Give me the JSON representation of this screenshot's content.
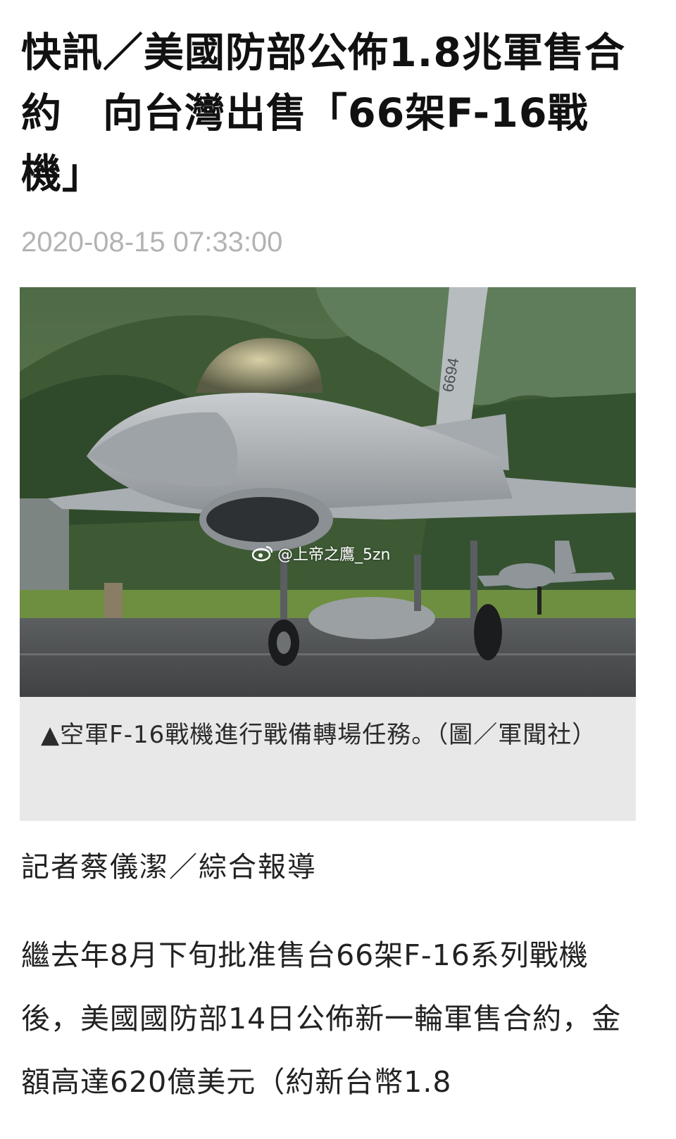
{
  "article": {
    "headline": "快訊／美國防部公佈1.8兆軍售合約　向台灣出售「66架F-16戰機」",
    "timestamp": "2020-08-15 07:33:00",
    "photo": {
      "watermark": "@上帝之鷹_5zn",
      "tail_number": "6694",
      "watermark_icon": "weibo-logo-icon"
    },
    "caption": "▲空軍F-16戰機進行戰備轉場任務。（圖／軍聞社）",
    "byline": "記者蔡儀潔／綜合報導",
    "body": "繼去年8月下旬批准售台66架F-16系列戰機後，美國國防部14日公佈新一輪軍售合約，金額高達620億美元（約新台幣1.8"
  }
}
